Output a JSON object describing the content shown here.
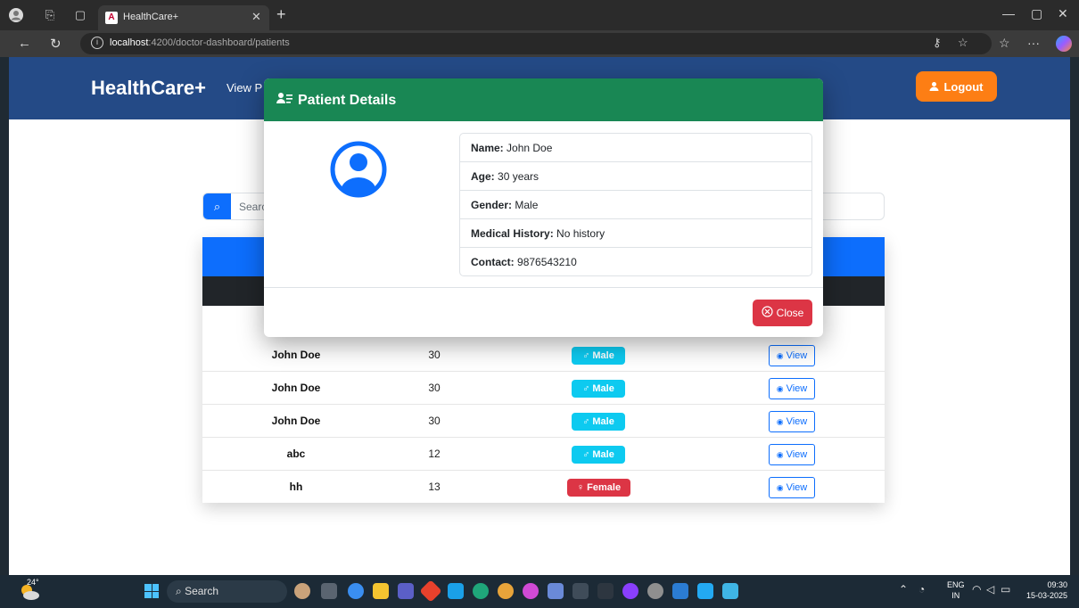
{
  "browser": {
    "tab_title": "HealthCare+",
    "tab_favicon": "A",
    "url_host": "localhost",
    "url_rest": ":4200/doctor-dashboard/patients"
  },
  "navbar": {
    "brand": "HealthCare+",
    "link_text": "View Patients",
    "logout_label": "Logout"
  },
  "search": {
    "placeholder": "Search"
  },
  "table": {
    "rows": [
      {
        "name": "John Doe",
        "age": "30",
        "gender": "Male"
      },
      {
        "name": "John Doe",
        "age": "30",
        "gender": "Male"
      },
      {
        "name": "John Doe",
        "age": "30",
        "gender": "Male"
      },
      {
        "name": "abc",
        "age": "12",
        "gender": "Male"
      },
      {
        "name": "hh",
        "age": "13",
        "gender": "Female"
      }
    ],
    "view_label": "View"
  },
  "modal": {
    "title": "Patient Details",
    "fields": [
      {
        "label": "Name:",
        "value": "John Doe"
      },
      {
        "label": "Age:",
        "value": "30 years"
      },
      {
        "label": "Gender:",
        "value": "Male"
      },
      {
        "label": "Medical History:",
        "value": "No history"
      },
      {
        "label": "Contact:",
        "value": "9876543210"
      }
    ],
    "close_label": "Close"
  },
  "taskbar": {
    "weather": "24°",
    "search_label": "Search",
    "lang_top": "ENG",
    "lang_bottom": "IN",
    "time": "09:30",
    "date": "15-03-2025"
  },
  "colors": {
    "navbar": "#244a86",
    "modal_header": "#198754",
    "primary": "#0d6efd",
    "logout": "#fd7e14",
    "danger": "#dc3545",
    "info": "#0dcaf0"
  }
}
